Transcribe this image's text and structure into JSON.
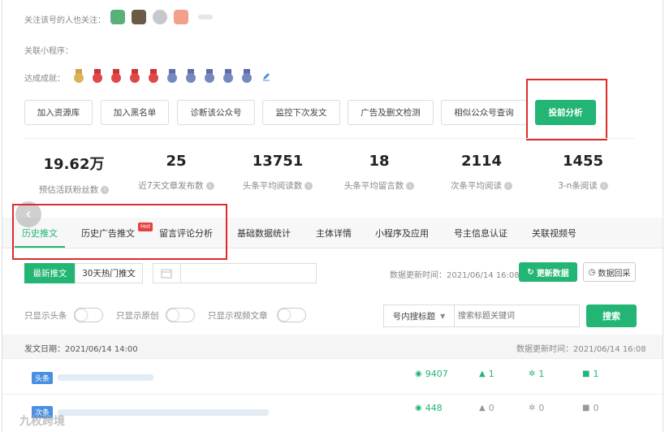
{
  "related": {
    "followers_label": "关注该号的人也关注：",
    "miniapp_label": "关联小程序：",
    "achievements_label": "达成成就："
  },
  "actions": {
    "add_resource": "加入资源库",
    "add_blacklist": "加入黑名单",
    "diagnose": "诊断该公众号",
    "monitor": "监控下次发文",
    "ad_check": "广告及删文检测",
    "similar": "相似公众号查询",
    "delivery": "投前分析"
  },
  "stats": [
    {
      "value": "19.62万",
      "label": "预估活跃粉丝数"
    },
    {
      "value": "25",
      "label": "近7天文章发布数"
    },
    {
      "value": "13751",
      "label": "头条平均阅读数"
    },
    {
      "value": "18",
      "label": "头条平均留言数"
    },
    {
      "value": "2114",
      "label": "次条平均阅读"
    },
    {
      "value": "1455",
      "label": "3-n条阅读"
    }
  ],
  "info_glyph": "i",
  "back_glyph": "‹",
  "tabs": {
    "history": "历史推文",
    "ads": "历史广告推文",
    "hot_badge": "Hot",
    "comments": "留言评论分析",
    "basic": "基础数据统计",
    "subject": "主体详情",
    "miniapp": "小程序及应用",
    "verify": "号主信息认证",
    "video": "关联视频号"
  },
  "filters": {
    "latest": "最新推文",
    "hot30": "30天热门推文",
    "update_time": "数据更新时间：2021/06/14 16:08",
    "refresh": "更新数据",
    "backtrack": "数据回采",
    "only_headline": "只显示头条",
    "only_original": "只显示原创",
    "only_video": "只显示视频文章",
    "search_scope": "号内搜标题",
    "search_placeholder": "搜索标题关键词",
    "search_btn": "搜索"
  },
  "list": {
    "date": "发文日期：2021/06/14 14:00",
    "update": "数据更新时间：2021/06/14 16:08",
    "rows": [
      {
        "tag": "头条",
        "reads": "9407",
        "likes": "1",
        "looks": "1",
        "comments": "1"
      },
      {
        "tag": "次条",
        "reads": "448",
        "likes": "0",
        "looks": "0",
        "comments": "0"
      }
    ]
  },
  "watermark": "九枚跨境",
  "colors": {
    "accent": "#22b573",
    "highlight": "#e02a2a",
    "tag": "#4a90e2"
  }
}
